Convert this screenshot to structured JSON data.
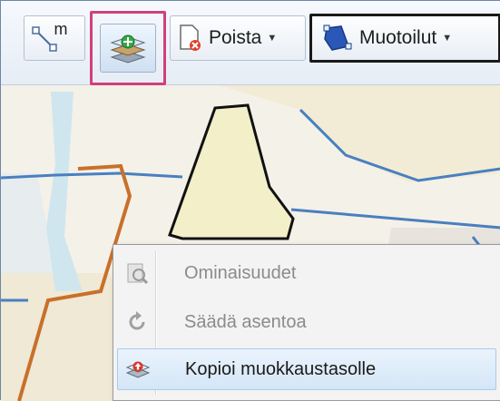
{
  "toolbar": {
    "measure_label": "m",
    "delete_label": "Poista",
    "shapes_label": "Muotoilut"
  },
  "context_menu": {
    "items": [
      {
        "label": "Ominaisuudet",
        "icon": "properties-icon",
        "enabled": false
      },
      {
        "label": "Säädä asentoa",
        "icon": "rotate-icon",
        "enabled": false
      },
      {
        "label": "Kopioi muokkaustasolle",
        "icon": "copy-to-edit-layer-icon",
        "enabled": true
      }
    ]
  },
  "colors": {
    "highlight_border": "#d0407a",
    "selected_border": "#1a1a1a",
    "parcel_orange": "#c8702a",
    "parcel_blue": "#4a7fc1",
    "selected_parcel_fill": "#f2efc9"
  }
}
